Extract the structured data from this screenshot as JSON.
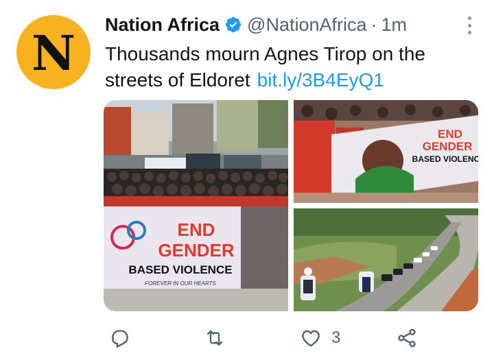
{
  "tweet": {
    "avatar_letter": "N",
    "display_name": "Nation Africa",
    "handle": "@NationAfrica",
    "separator": "·",
    "time": "1m",
    "text": "Thousands mourn Agnes Tirop on the streets of Eldoret",
    "link": "bit.ly/3B4EyQ1"
  },
  "media": {
    "banner1": {
      "line1": "END",
      "line2": "GENDER",
      "line3": "BASED VIOLENCE",
      "line4": "FOREVER IN OUR HEARTS"
    },
    "banner2": {
      "line1": "END",
      "line2": "GENDER",
      "line3": "BASED VIOLENC"
    }
  },
  "actions": {
    "reply_icon": "reply-icon",
    "retweet_icon": "retweet-icon",
    "like_icon": "like-icon",
    "like_count": "3",
    "share_icon": "share-icon"
  },
  "colors": {
    "accent": "#1d9bf0",
    "avatar_bg": "#f6b21f",
    "text_secondary": "#536471",
    "icon_gray": "#536471"
  }
}
